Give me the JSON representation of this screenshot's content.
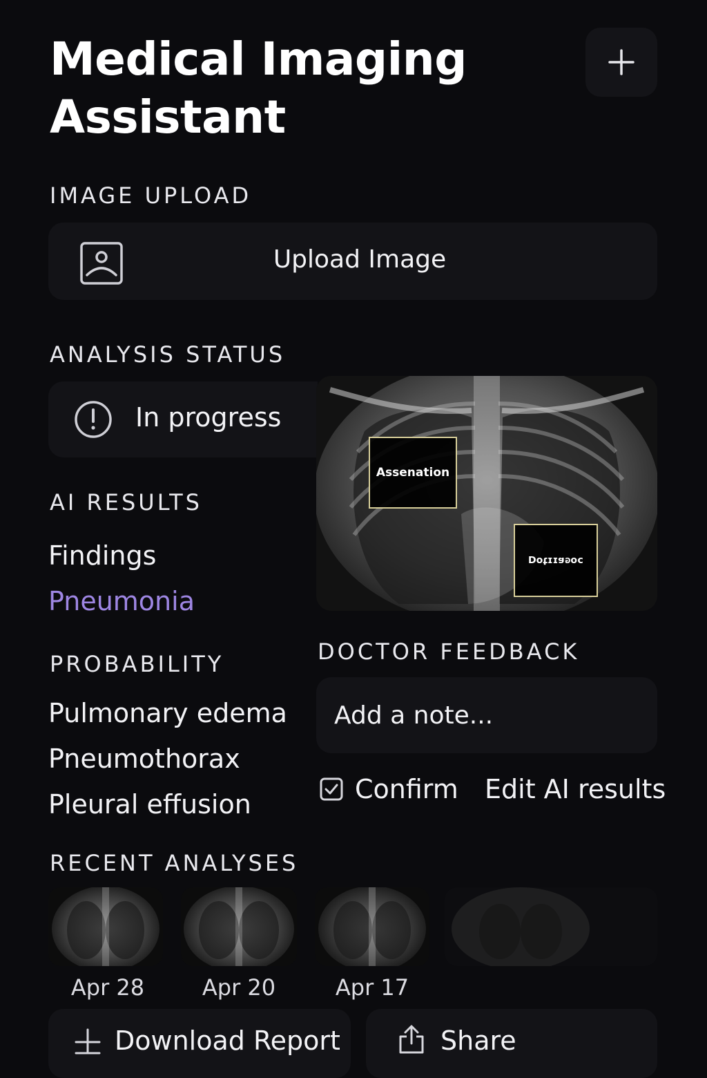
{
  "header": {
    "title_line1": "Medical Imaging",
    "title_line2": "Assistant",
    "new_button_icon": "plus-icon"
  },
  "upload": {
    "section_label": "IMAGE UPLOAD",
    "button_label": "Upload Image",
    "icon": "image-upload-icon"
  },
  "status": {
    "section_label": "ANALYSIS STATUS",
    "value": "In progress",
    "icon": "alert-circle-icon"
  },
  "xray": {
    "annotations": [
      "Assenation",
      "ɔoɢɐɪɪʇoꓷ"
    ]
  },
  "results": {
    "section_label": "AI RESULTS",
    "findings_label": "Findings",
    "findings_value": "Pneumonia",
    "findings_color": "#9e86e3"
  },
  "probability": {
    "section_label": "PROBABILITY",
    "items": [
      "Pulmonary edema",
      "Pneumothorax",
      "Pleural effusion"
    ]
  },
  "feedback": {
    "section_label": "DOCTOR FEEDBACK",
    "placeholder": "Add a note...",
    "confirm_label": "Confirm",
    "edit_label": "Edit AI results"
  },
  "recent": {
    "section_label": "RECENT ANALYSES",
    "items": [
      {
        "date": "Apr 28"
      },
      {
        "date": "Apr 20"
      },
      {
        "date": "Apr 17"
      }
    ]
  },
  "actions": {
    "download_label": "Download Report",
    "share_label": "Share"
  },
  "theme": {
    "background": "#0b0b0e",
    "card": "#131317",
    "accent": "#9e86e3"
  }
}
